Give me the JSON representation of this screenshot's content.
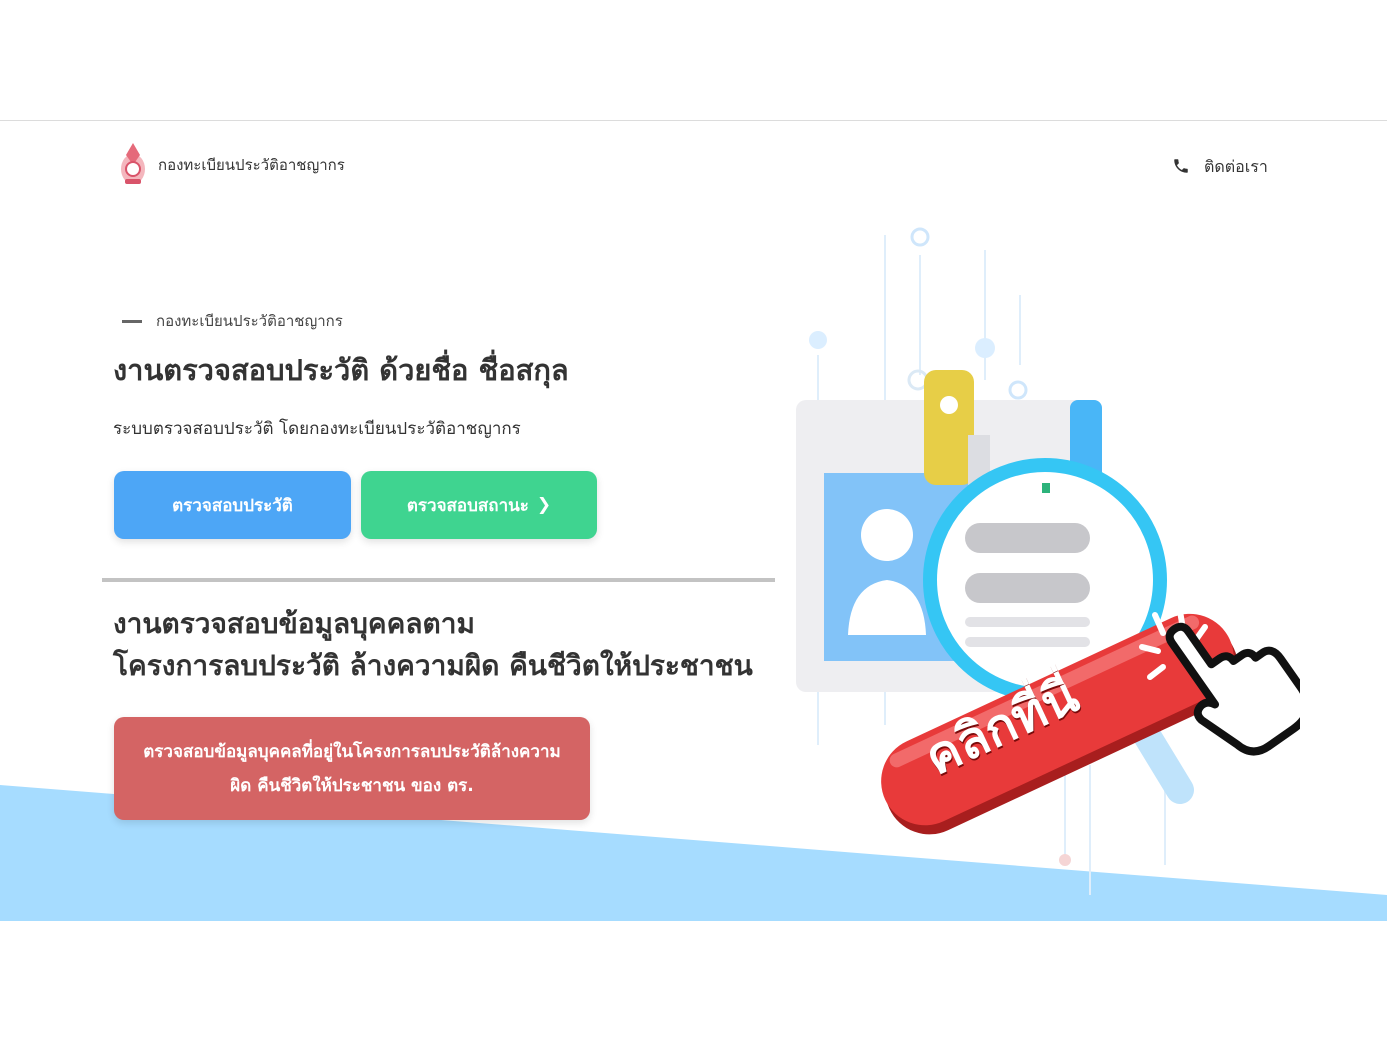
{
  "header": {
    "brand": "กองทะเบียนประวัติอาชญากร",
    "contact_label": "ติดต่อเรา"
  },
  "hero": {
    "eyebrow": "กองทะเบียนประวัติอาชญากร",
    "title": "งานตรวจสอบประวัติ ด้วยชื่อ ชื่อสกุล",
    "subtitle": "ระบบตรวจสอบประวัติ โดยกองทะเบียนประวัติอาชญากร",
    "btn_check_history": "ตรวจสอบประวัติ",
    "btn_check_status": "ตรวจสอบสถานะ",
    "btn_check_status_arrow": "❯"
  },
  "section2": {
    "title_line1": "งานตรวจสอบข้อมูลบุคคลตาม",
    "title_line2": "โครงการลบประวัติ ล้างความผิด คืนชีวิตให้ประชาชน",
    "btn_line1": "ตรวจสอบข้อมูลบุคคลที่อยู่ในโครงการลบประวัติล้างความ",
    "btn_line2": "ผิด คืนชีวิตให้ประชาชน ของ ตร."
  },
  "badge": {
    "text": "คลิกที่นี่"
  },
  "colors": {
    "blue_button": "#4da6f6",
    "green_button": "#3fd490",
    "red_button": "#d46464",
    "badge_red": "#e83a3a",
    "footer_band": "#a6dcff"
  },
  "icons": {
    "logo": "police-emblem-icon",
    "contact": "phone-icon",
    "hand": "pointing-hand-icon"
  }
}
